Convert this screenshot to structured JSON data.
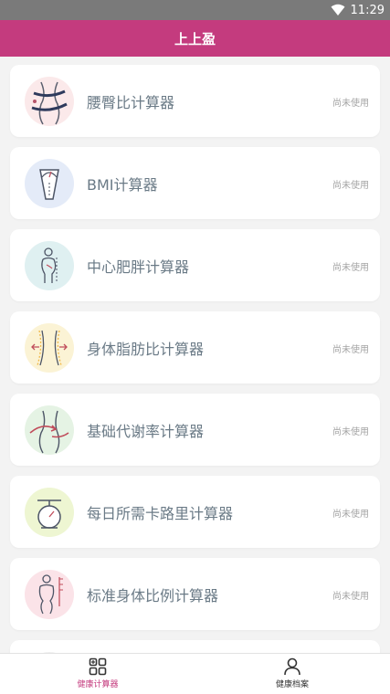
{
  "status_bar": {
    "time": "11:29"
  },
  "header": {
    "title": "上上盈"
  },
  "calculators": [
    {
      "title": "腰臀比计算器",
      "status": "尚未使用",
      "icon": "waist-hip-icon"
    },
    {
      "title": "BMI计算器",
      "status": "尚未使用",
      "icon": "bmi-scale-icon"
    },
    {
      "title": "中心肥胖计算器",
      "status": "尚未使用",
      "icon": "central-obesity-icon"
    },
    {
      "title": "身体脂肪比计算器",
      "status": "尚未使用",
      "icon": "body-fat-icon"
    },
    {
      "title": "基础代谢率计算器",
      "status": "尚未使用",
      "icon": "metabolic-rate-icon"
    },
    {
      "title": "每日所需卡路里计算器",
      "status": "尚未使用",
      "icon": "calorie-scale-icon"
    },
    {
      "title": "标准身体比例计算器",
      "status": "尚未使用",
      "icon": "body-proportion-icon"
    }
  ],
  "bottom_nav": {
    "items": [
      {
        "label": "健康计算器",
        "icon": "grid-icon",
        "active": true
      },
      {
        "label": "健康档案",
        "icon": "person-icon",
        "active": false
      }
    ]
  },
  "colors": {
    "brand": "#c43b7e",
    "status_bar": "#7a7a7a",
    "card_title": "#6a7a86",
    "status_text": "#a4a4a4"
  }
}
